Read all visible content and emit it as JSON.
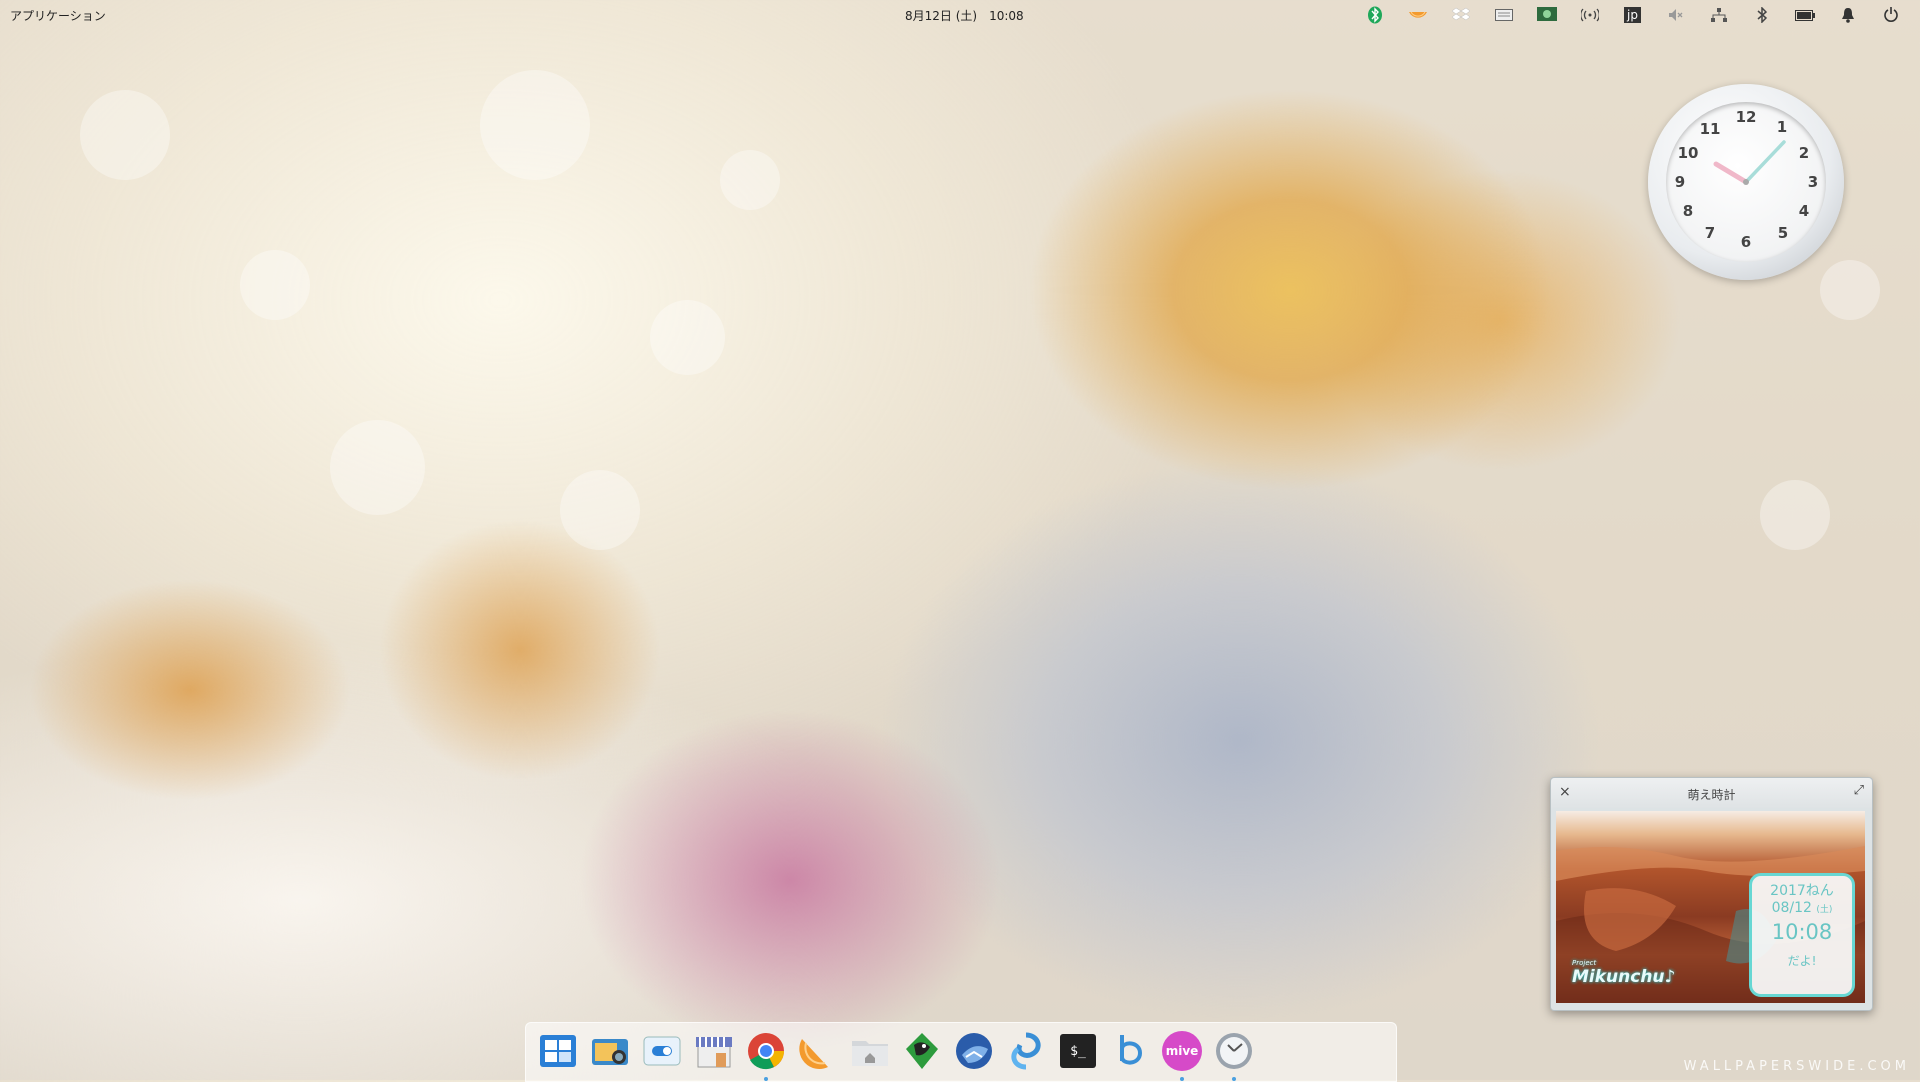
{
  "top_panel": {
    "apps_menu": "アプリケーション",
    "clock": "8月12日 (土)　10:08",
    "tray": [
      {
        "name": "bluetooth-app-icon"
      },
      {
        "name": "orange-slice-icon"
      },
      {
        "name": "dropbox-icon"
      },
      {
        "name": "keyboard-icon"
      },
      {
        "name": "display-icon"
      },
      {
        "name": "wireless-icon"
      },
      {
        "name": "input-method-icon",
        "text": "jp"
      },
      {
        "name": "volume-muted-icon"
      },
      {
        "name": "network-icon"
      },
      {
        "name": "bluetooth-icon"
      },
      {
        "name": "battery-icon"
      },
      {
        "name": "notification-bell-icon"
      },
      {
        "name": "power-icon"
      }
    ]
  },
  "analog_clock": {
    "numbers": [
      "12",
      "1",
      "2",
      "3",
      "4",
      "5",
      "6",
      "7",
      "8",
      "9",
      "10",
      "11"
    ],
    "time": "10:08"
  },
  "moe_clock_window": {
    "title": "萌え時計",
    "close": "×",
    "maximize": "⤢",
    "year": "2017ねん",
    "date": "08/12",
    "weekday": "(土)",
    "time": "10:08",
    "suffix": "だよ!",
    "brand_small": "Project",
    "brand": "Mikunchu♪"
  },
  "dock": {
    "items": [
      {
        "name": "multitasking-view-icon"
      },
      {
        "name": "screenshot-icon"
      },
      {
        "name": "control-center-icon"
      },
      {
        "name": "app-store-icon"
      },
      {
        "name": "chrome-icon"
      },
      {
        "name": "orange-slice-icon"
      },
      {
        "name": "file-manager-icon"
      },
      {
        "name": "gimp-icon"
      },
      {
        "name": "thunderbird-icon"
      },
      {
        "name": "swirl-app-icon"
      },
      {
        "name": "terminal-icon",
        "text": "$_"
      },
      {
        "name": "bash-icon"
      },
      {
        "name": "mive-tokei-icon",
        "text": "mive"
      },
      {
        "name": "clock-app-icon"
      }
    ]
  },
  "watermark": "WALLPAPERSWIDE.COM",
  "colors": {
    "dock_indicator": "#4aa0e0",
    "moe_accent": "#67d7d3"
  }
}
